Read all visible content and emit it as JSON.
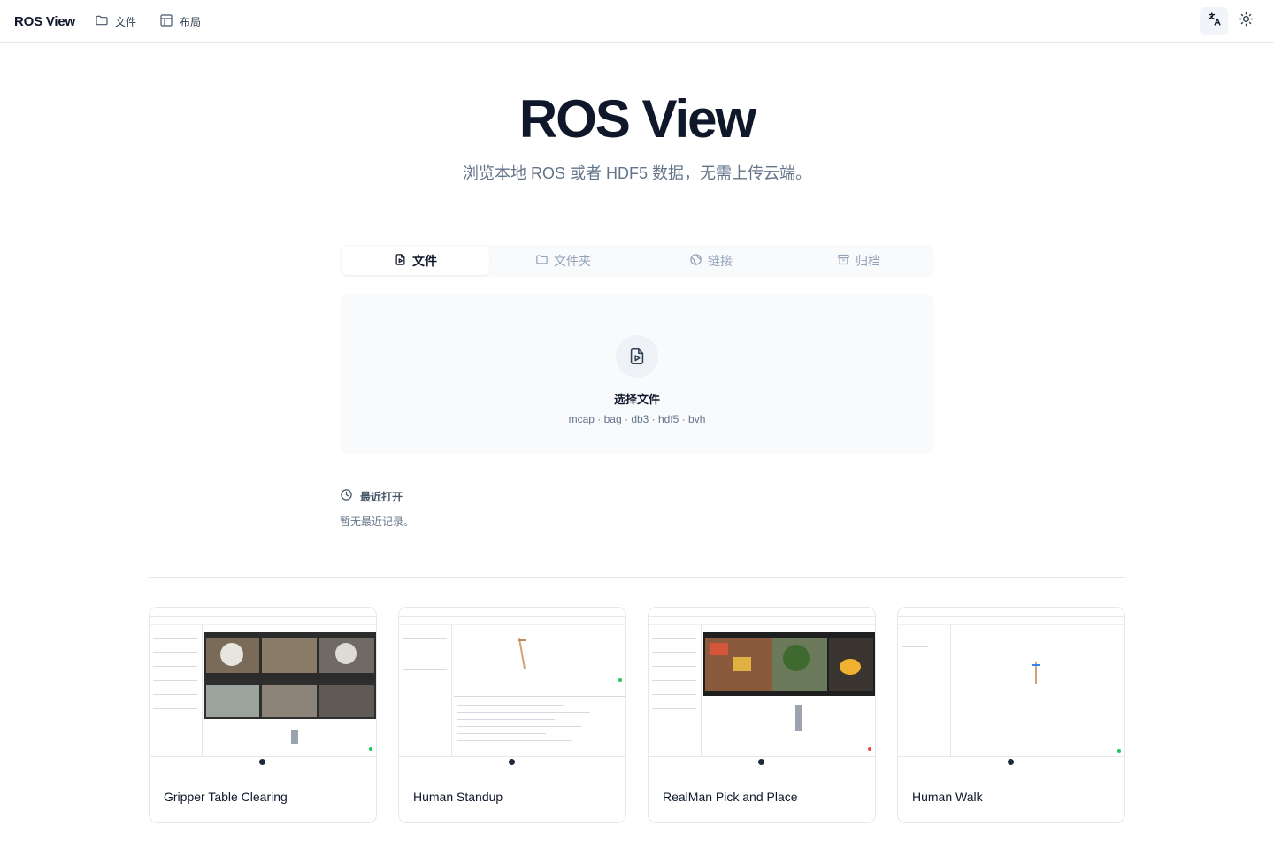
{
  "topbar": {
    "brand": "ROS View",
    "nav": [
      {
        "label": "文件",
        "icon": "folder-icon"
      },
      {
        "label": "布局",
        "icon": "layout-icon"
      }
    ],
    "actions": [
      {
        "icon": "translate-icon"
      },
      {
        "icon": "sun-icon"
      }
    ]
  },
  "hero": {
    "title": "ROS View",
    "subtitle": "浏览本地 ROS 或者 HDF5 数据，无需上传云端。"
  },
  "tabs": [
    {
      "label": "文件",
      "icon": "file-play-icon",
      "active": true
    },
    {
      "label": "文件夹",
      "icon": "folder-icon",
      "active": false
    },
    {
      "label": "链接",
      "icon": "globe-icon",
      "active": false
    },
    {
      "label": "归档",
      "icon": "archive-icon",
      "active": false
    }
  ],
  "dropzone": {
    "title": "选择文件",
    "formats": "mcap · bag · db3 · hdf5 · bvh"
  },
  "recent": {
    "heading": "最近打开",
    "empty": "暂无最近记录。"
  },
  "examples": [
    {
      "title": "Gripper Table Clearing"
    },
    {
      "title": "Human Standup"
    },
    {
      "title": "RealMan Pick and Place"
    },
    {
      "title": "Human Walk"
    }
  ],
  "colors": {
    "text": "#0f172a",
    "muted": "#64748b",
    "border": "#e5e7eb",
    "surface": "#f8fafc"
  }
}
